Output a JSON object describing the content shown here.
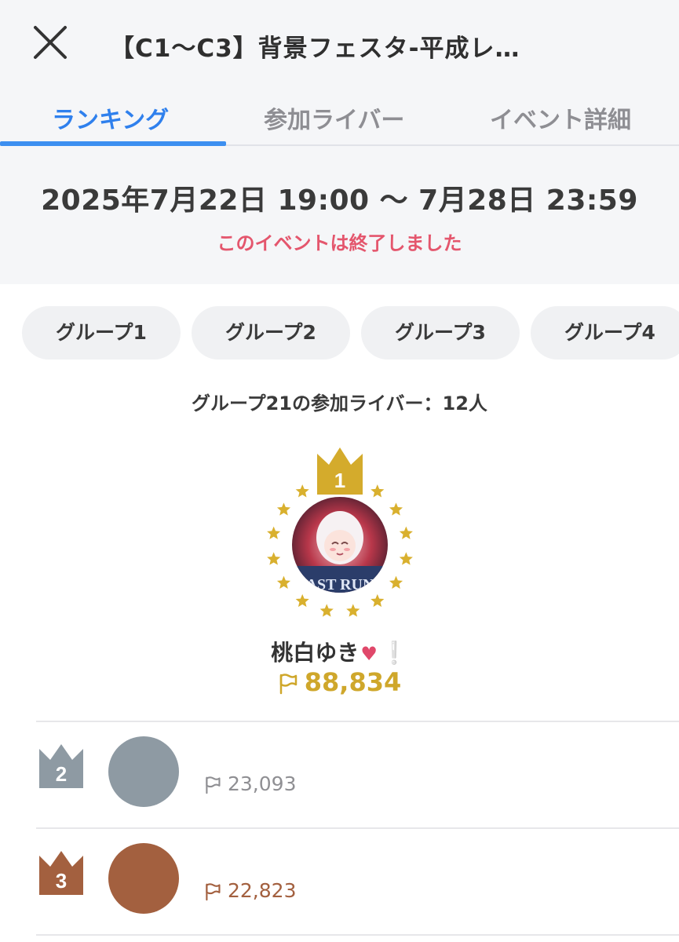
{
  "header": {
    "title": "【C1〜C3】背景フェスタ-平成レ…",
    "close_icon": "close-icon"
  },
  "tabs": [
    {
      "label": "ランキング",
      "active": true
    },
    {
      "label": "参加ライバー",
      "active": false
    },
    {
      "label": "イベント詳細",
      "active": false
    }
  ],
  "event": {
    "period": "2025年7月22日 19:00 〜 7月28日 23:59",
    "status": "このイベントは終了しました"
  },
  "groups": [
    "グループ1",
    "グループ2",
    "グループ3",
    "グループ4"
  ],
  "group_info": "グループ21の参加ライバー：12人",
  "winner": {
    "rank": "1",
    "name": "桃白ゆき",
    "name_emoji": "♥",
    "name_suffix": "❕",
    "score": "88,834"
  },
  "ranking": [
    {
      "rank": "2",
      "score": "23,093",
      "color": "#8e9aa3"
    },
    {
      "rank": "3",
      "score": "22,823",
      "color": "#a3603f"
    }
  ],
  "colors": {
    "accent": "#2f80ed",
    "gold": "#cfa72b",
    "status_red": "#e4566d",
    "silver": "#8e9aa3",
    "bronze": "#a3603f"
  }
}
